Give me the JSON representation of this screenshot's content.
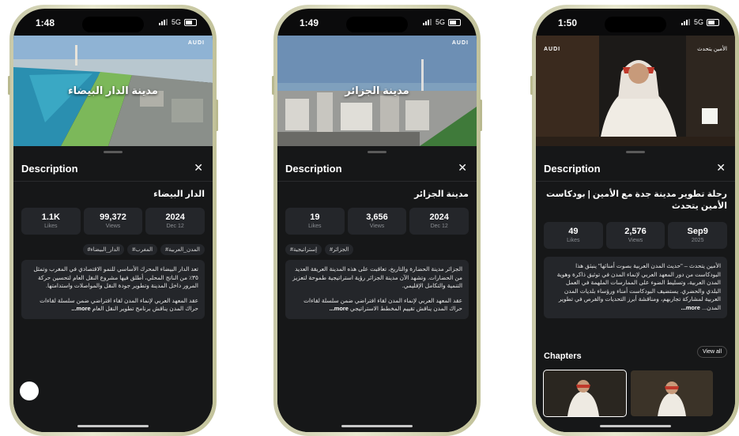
{
  "phones": [
    {
      "time": "1:48",
      "signal": "5G",
      "hero_title": "مدينة الدار البيضاء",
      "logo": "AUDI",
      "description_title": "Description",
      "video_title": "الدار البيضاء",
      "stats": [
        {
          "value": "1.1K",
          "label": "Likes"
        },
        {
          "value": "99,372",
          "label": "Views"
        },
        {
          "value": "2024",
          "label": "Dec 12"
        }
      ],
      "tags": [
        "#الدار_البيضاء",
        "#المغرب",
        "#المدن_العربية"
      ],
      "paragraph1": "تعد الدار البيضاء المحرك الأساسي للنمو الاقتصادي في المغرب وتمثل ٣٥٪ من الناتج المحلي، أطلق فيها مشروع النقل العام لتحسين حركة المرور داخل المدينة وتطوير جودة النقل والمواصلات واستدامتها.",
      "paragraph2": "عقد المعهد العربي لإنماء المدن لقاء افتراضي ضمن سلسلة لقاءات حراك المدن يناقش برنامج تطوير النقل العام",
      "more": "more..."
    },
    {
      "time": "1:49",
      "signal": "5G",
      "hero_title": "مدينة الجزائر",
      "logo": "AUDI",
      "description_title": "Description",
      "video_title": "مدينة الجزائر",
      "stats": [
        {
          "value": "19",
          "label": "Likes"
        },
        {
          "value": "3,656",
          "label": "Views"
        },
        {
          "value": "2024",
          "label": "Dec 12"
        }
      ],
      "tags": [
        "#الجزائر",
        "#إستراتيجية"
      ],
      "paragraph1": "الجزائر مدينة الحضارة والتاريخ، تعاقبت على هذه المدينة العريقة العديد من الحضارات. وتشهد الآن مدينة الجزائر رؤية استراتيجية طموحة لتعزيز التنمية والتكامل الإقليمي.",
      "paragraph2": "عقد المعهد العربي لإنماء المدن لقاء افتراضي ضمن سلسلة لقاءات حراك المدن يناقش تقييم المخطط الاستراتيجي",
      "more": "more..."
    },
    {
      "time": "1:50",
      "signal": "5G",
      "logo": "AUDI",
      "logo_right": "الأمين يتحدث",
      "description_title": "Description",
      "video_title": "رحلة تطوير مدينة جدة مع الأمين | بودكاست الأمين يتحدث",
      "stats": [
        {
          "value": "49",
          "label": "Likes"
        },
        {
          "value": "2,576",
          "label": "Views"
        },
        {
          "value": "Sep9",
          "label": "2025"
        }
      ],
      "paragraph1": "الأمين يتحدث – \"حديث المدن العربية بصوت أمنائها\" ينبثق هذا البودكاست من دور المعهد العربي لإنماء المدن في توثيق ذاكرة وهوية المدن العربية، وتسليط الضوء على الممارسات الملهمة في العمل البلدي والحضري. يستضيف البودكاست أمناء ورؤساء بلديات المدن العربية لمشاركة تجاربهم، ومناقشة أبرز التحديات والفرص في تطوير المدن...",
      "more": "more...",
      "chapters_title": "Chapters",
      "view_all": "View all"
    }
  ]
}
